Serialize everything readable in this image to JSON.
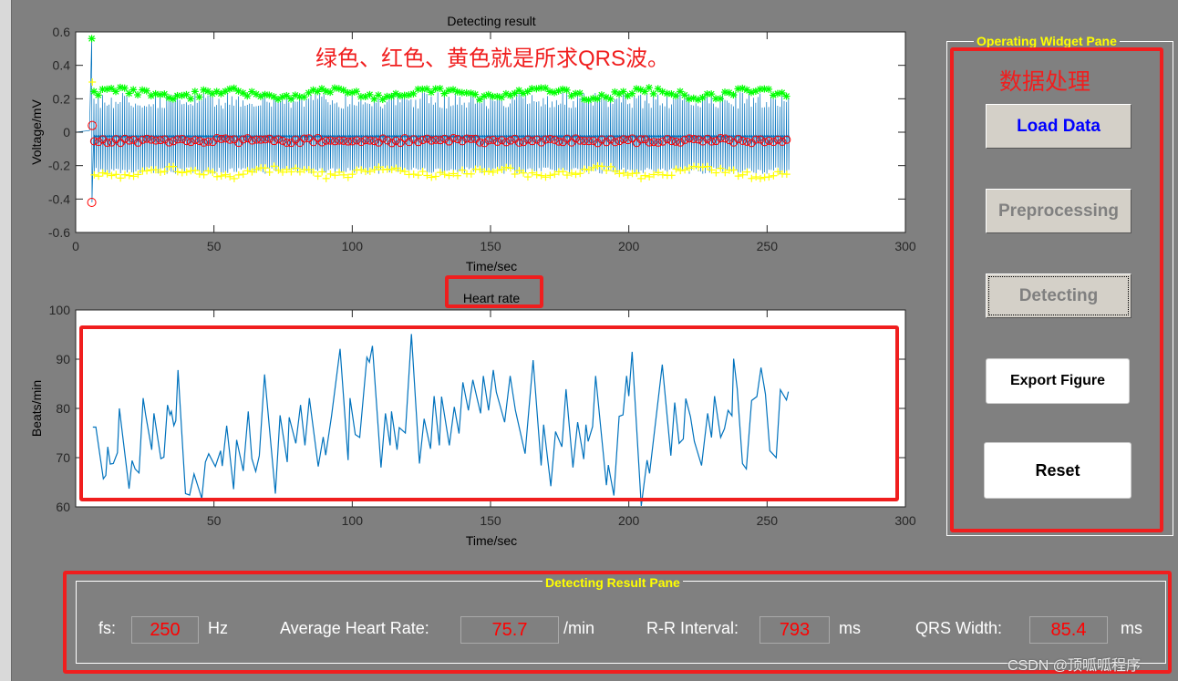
{
  "annotation_top": "绿色、红色、黄色就是所求QRS波。",
  "annotation_pane": "数据处理",
  "watermark": "CSDN @顶呱呱程序",
  "colors": {
    "background": "#808080",
    "signal": "#0072bd",
    "r_peak": "#00ff00",
    "q_s_marker": "#ff0000",
    "s_marker": "#ffff00",
    "highlight": "#f01e1e",
    "pane_title": "#ffff00"
  },
  "chart_data": [
    {
      "type": "line",
      "title": "Detecting result",
      "xlabel": "Time/sec",
      "ylabel": "Voltage/mV",
      "xlim": [
        0,
        300
      ],
      "ylim": [
        -0.6,
        0.6
      ],
      "xticks": [
        0,
        50,
        100,
        150,
        200,
        250,
        300
      ],
      "yticks": [
        -0.6,
        -0.4,
        -0.2,
        0,
        0.2,
        0.4,
        0.6
      ],
      "signal_time_range": [
        0,
        258
      ],
      "series": [
        {
          "marker": "line",
          "color": "#0072bd",
          "typical_range": [
            -0.25,
            0.24
          ]
        },
        {
          "marker": "*",
          "color": "#00ff00",
          "typical_value": 0.23,
          "first_point": [
            5.8,
            0.56
          ]
        },
        {
          "marker": "o",
          "color": "#ff0000",
          "typical_value": -0.05,
          "first_point": [
            5.8,
            -0.42
          ]
        },
        {
          "marker": "+",
          "color": "#ffff00",
          "typical_value": -0.24,
          "first_point": [
            6.0,
            0.3
          ]
        }
      ]
    },
    {
      "type": "line",
      "title": "Heart rate",
      "xlabel": "Time/sec",
      "ylabel": "Beats/min",
      "xlim": [
        0,
        300
      ],
      "ylim": [
        60,
        100
      ],
      "xticks": [
        50,
        100,
        150,
        200,
        250,
        300
      ],
      "yticks": [
        60,
        70,
        80,
        90,
        100
      ],
      "x": [
        6.2,
        7.3,
        10,
        10.9,
        11.6,
        12.5,
        13.6,
        15.1,
        15.8,
        19.3,
        20.4,
        21.5,
        22.9,
        24.4,
        25.3,
        27.5,
        28.3,
        30.8,
        31.9,
        33.2,
        34.1,
        34.6,
        35.5,
        36.2,
        37,
        39.7,
        41.2,
        42.8,
        45.6,
        46.9,
        48.1,
        50.5,
        52.4,
        53,
        54.6,
        57.1,
        58.2,
        60.6,
        62.4,
        63.7,
        65.1,
        66.4,
        68.3,
        72.2,
        73.9,
        76.5,
        77.2,
        79.6,
        81.3,
        82.9,
        84.5,
        87.7,
        89.5,
        90.4,
        92.5,
        95.6,
        98.5,
        99.2,
        101.1,
        102.7,
        105.3,
        106.2,
        107.3,
        110.4,
        112,
        113.7,
        114.2,
        116.2,
        117,
        119.2,
        121.4,
        124.3,
        126,
        128.3,
        129.6,
        131.5,
        132.3,
        135.1,
        136.9,
        138.6,
        140,
        142,
        143.6,
        146.4,
        147.4,
        149.3,
        151,
        152.1,
        155.1,
        157.1,
        159,
        162.5,
        165.4,
        168.3,
        169.2,
        171.8,
        173.5,
        175.8,
        177.3,
        179.8,
        181.5,
        183.7,
        184.5,
        185.3,
        186.9,
        188,
        191.9,
        192.6,
        194.6,
        196.5,
        197.9,
        199.2,
        200,
        201.2,
        204.5,
        206.6,
        207.5,
        212.1,
        215.2,
        216.6,
        218.2,
        219.7,
        220.6,
        222.3,
        223.7,
        226.3,
        228.5,
        229.9,
        231,
        233.2,
        234.6,
        235.9,
        237.3,
        237.9,
        239.2,
        241.1,
        242.5,
        244.4,
        246.3,
        247.8,
        249.4,
        251,
        253.3,
        254.8,
        257,
        257.7
      ],
      "y": [
        76.2,
        76.2,
        65.7,
        66.4,
        72.2,
        68.7,
        68.8,
        71,
        80,
        63.7,
        69.4,
        67.7,
        66.9,
        82.1,
        78.7,
        71.6,
        79,
        69.8,
        70.1,
        80.7,
        78.7,
        79.4,
        76.5,
        77.5,
        87.8,
        62.7,
        62.4,
        66.7,
        61.7,
        69.1,
        70.8,
        68.2,
        71.4,
        68.3,
        76.5,
        63.6,
        73.6,
        67.3,
        79.4,
        69.8,
        67.2,
        70.4,
        86.9,
        62.7,
        78.6,
        69.1,
        78.2,
        72.9,
        80.7,
        72.5,
        82.1,
        68.2,
        74.2,
        70.5,
        78.4,
        92.1,
        69.5,
        82.1,
        74.7,
        74.1,
        90.4,
        89.4,
        92.7,
        68,
        79,
        72.5,
        79.4,
        71.6,
        76.1,
        75,
        95.1,
        68.8,
        77.9,
        71.8,
        82.5,
        72.5,
        82.4,
        72.5,
        80.3,
        74.9,
        85.3,
        79.6,
        85.8,
        79,
        86.6,
        79.6,
        87.8,
        83.3,
        77.2,
        86.6,
        79.6,
        70.8,
        89.8,
        68.4,
        76.7,
        64.2,
        75.3,
        72.2,
        83.9,
        68,
        77.2,
        69.7,
        76.7,
        73.3,
        76.3,
        86.6,
        64.4,
        68.5,
        62.3,
        78.4,
        78.7,
        86.6,
        82.5,
        91.5,
        60.2,
        69.5,
        66.8,
        88.9,
        70.4,
        81.2,
        72.9,
        73.8,
        82,
        78.3,
        73.3,
        68.4,
        79,
        74.1,
        82.5,
        74.1,
        75.9,
        79.6,
        78.5,
        90.1,
        84,
        68.8,
        67.7,
        81.6,
        82.4,
        88.3,
        82.9,
        71.4,
        70,
        83.8,
        81.7,
        83.4
      ]
    }
  ],
  "operating_pane": {
    "title": "Operating Widget Pane",
    "buttons": [
      {
        "label": "Load Data",
        "state": "enabled"
      },
      {
        "label": "Preprocessing",
        "state": "disabled"
      },
      {
        "label": "Detecting",
        "state": "disabled-focused"
      },
      {
        "label": "Export Figure",
        "state": "enabled"
      },
      {
        "label": "Reset",
        "state": "enabled"
      }
    ]
  },
  "result_pane": {
    "title": "Detecting Result Pane",
    "fs": {
      "label": "fs:",
      "value": "250",
      "unit": "Hz"
    },
    "avg_hr": {
      "label": "Average Heart Rate:",
      "value": "75.7",
      "unit": "/min"
    },
    "rr": {
      "label": "R-R Interval:",
      "value": "793",
      "unit": "ms"
    },
    "qrs": {
      "label": "QRS Width:",
      "value": "85.4",
      "unit": "ms"
    }
  }
}
